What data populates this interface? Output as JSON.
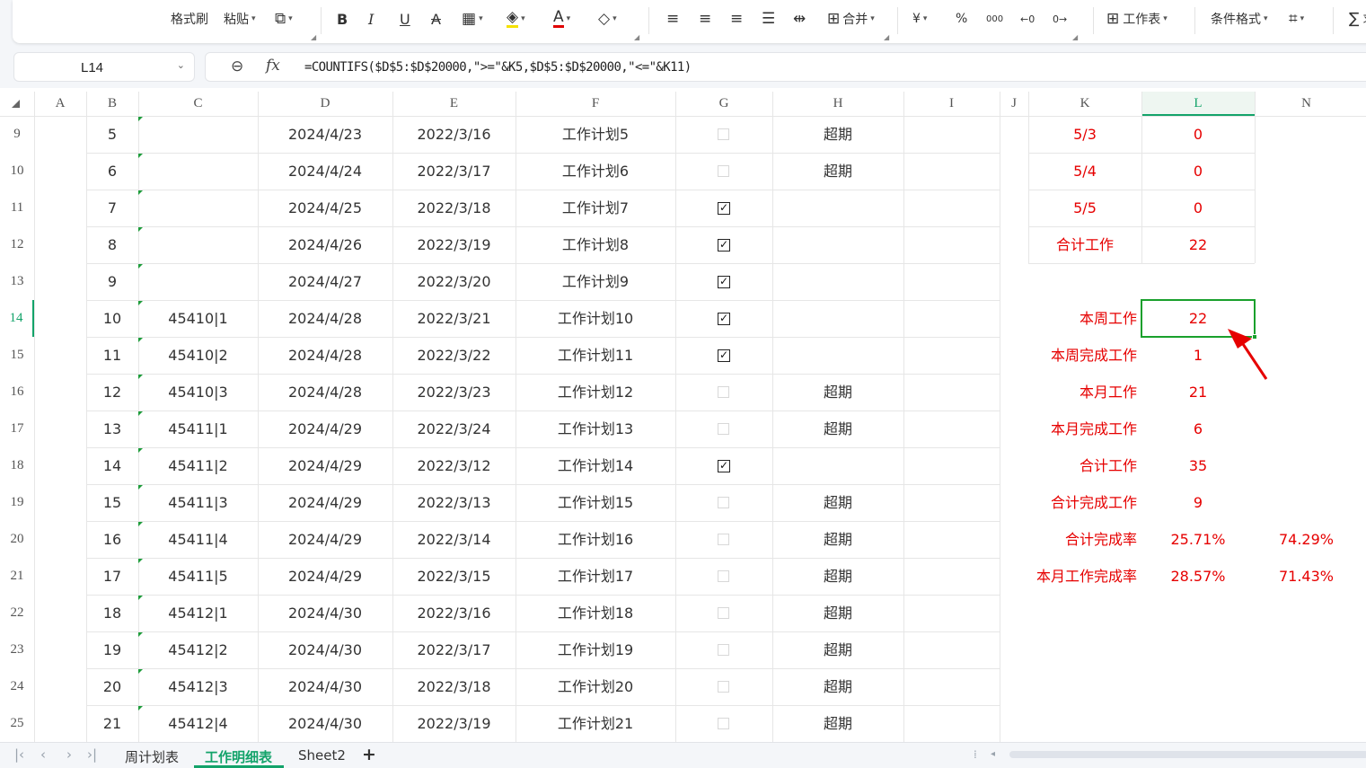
{
  "toolbar": {
    "format_painter": "格式刷",
    "paste": "粘贴",
    "bold": "B",
    "italic": "I",
    "underline": "U",
    "strikethrough": "A",
    "merge": "合并",
    "currency": "¥",
    "percent": "%",
    "thousands": "000",
    "worksheet": "工作表",
    "conditional_format": "条件格式",
    "sum": "∑",
    "sum_cut": "求"
  },
  "formula_bar": {
    "cell_ref": "L14",
    "fx": "fx",
    "formula": "=COUNTIFS($D$5:$D$20000,\">=\"&K5,$D$5:$D$20000,\"<=\"&K11)"
  },
  "columns": [
    "A",
    "B",
    "C",
    "D",
    "E",
    "F",
    "G",
    "H",
    "I",
    "J",
    "K",
    "L",
    "N"
  ],
  "selected_column": "L",
  "selected_row": "14",
  "rows": [
    {
      "row": "9",
      "b": "5",
      "c": "",
      "d": "2024/4/23",
      "e": "2022/3/16",
      "f": "工作计划5",
      "g": false,
      "h": "超期",
      "k": "5/3",
      "l": "0",
      "n": ""
    },
    {
      "row": "10",
      "b": "6",
      "c": "",
      "d": "2024/4/24",
      "e": "2022/3/17",
      "f": "工作计划6",
      "g": false,
      "h": "超期",
      "k": "5/4",
      "l": "0",
      "n": ""
    },
    {
      "row": "11",
      "b": "7",
      "c": "",
      "d": "2024/4/25",
      "e": "2022/3/18",
      "f": "工作计划7",
      "g": true,
      "h": "",
      "k": "5/5",
      "l": "0",
      "n": ""
    },
    {
      "row": "12",
      "b": "8",
      "c": "",
      "d": "2024/4/26",
      "e": "2022/3/19",
      "f": "工作计划8",
      "g": true,
      "h": "",
      "k": "合计工作",
      "l": "22",
      "n": ""
    },
    {
      "row": "13",
      "b": "9",
      "c": "",
      "d": "2024/4/27",
      "e": "2022/3/20",
      "f": "工作计划9",
      "g": true,
      "h": "",
      "k": "",
      "l": "",
      "n": ""
    },
    {
      "row": "14",
      "b": "10",
      "c": "45410|1",
      "d": "2024/4/28",
      "e": "2022/3/21",
      "f": "工作计划10",
      "g": true,
      "h": "",
      "k": "本周工作",
      "l": "22",
      "n": ""
    },
    {
      "row": "15",
      "b": "11",
      "c": "45410|2",
      "d": "2024/4/28",
      "e": "2022/3/22",
      "f": "工作计划11",
      "g": true,
      "h": "",
      "k": "本周完成工作",
      "l": "1",
      "n": ""
    },
    {
      "row": "16",
      "b": "12",
      "c": "45410|3",
      "d": "2024/4/28",
      "e": "2022/3/23",
      "f": "工作计划12",
      "g": false,
      "h": "超期",
      "k": "本月工作",
      "l": "21",
      "n": ""
    },
    {
      "row": "17",
      "b": "13",
      "c": "45411|1",
      "d": "2024/4/29",
      "e": "2022/3/24",
      "f": "工作计划13",
      "g": false,
      "h": "超期",
      "k": "本月完成工作",
      "l": "6",
      "n": ""
    },
    {
      "row": "18",
      "b": "14",
      "c": "45411|2",
      "d": "2024/4/29",
      "e": "2022/3/12",
      "f": "工作计划14",
      "g": true,
      "h": "",
      "k": "合计工作",
      "l": "35",
      "n": ""
    },
    {
      "row": "19",
      "b": "15",
      "c": "45411|3",
      "d": "2024/4/29",
      "e": "2022/3/13",
      "f": "工作计划15",
      "g": false,
      "h": "超期",
      "k": "合计完成工作",
      "l": "9",
      "n": ""
    },
    {
      "row": "20",
      "b": "16",
      "c": "45411|4",
      "d": "2024/4/29",
      "e": "2022/3/14",
      "f": "工作计划16",
      "g": false,
      "h": "超期",
      "k": "合计完成率",
      "l": "25.71%",
      "n": "74.29%"
    },
    {
      "row": "21",
      "b": "17",
      "c": "45411|5",
      "d": "2024/4/29",
      "e": "2022/3/15",
      "f": "工作计划17",
      "g": false,
      "h": "超期",
      "k": "本月工作完成率",
      "l": "28.57%",
      "n": "71.43%"
    },
    {
      "row": "22",
      "b": "18",
      "c": "45412|1",
      "d": "2024/4/30",
      "e": "2022/3/16",
      "f": "工作计划18",
      "g": false,
      "h": "超期",
      "k": "",
      "l": "",
      "n": ""
    },
    {
      "row": "23",
      "b": "19",
      "c": "45412|2",
      "d": "2024/4/30",
      "e": "2022/3/17",
      "f": "工作计划19",
      "g": false,
      "h": "超期",
      "k": "",
      "l": "",
      "n": ""
    },
    {
      "row": "24",
      "b": "20",
      "c": "45412|3",
      "d": "2024/4/30",
      "e": "2022/3/18",
      "f": "工作计划20",
      "g": false,
      "h": "超期",
      "k": "",
      "l": "",
      "n": ""
    },
    {
      "row": "25",
      "b": "21",
      "c": "45412|4",
      "d": "2024/4/30",
      "e": "2022/3/19",
      "f": "工作计划21",
      "g": false,
      "h": "超期",
      "k": "",
      "l": "",
      "n": ""
    }
  ],
  "sheet_tabs": [
    "周计划表",
    "工作明细表",
    "Sheet2"
  ],
  "active_tab": "工作明细表",
  "colors": {
    "accent": "#13a36a",
    "summary_text": "#e60000",
    "selection": "#19a02c",
    "arrow": "#e60000"
  }
}
